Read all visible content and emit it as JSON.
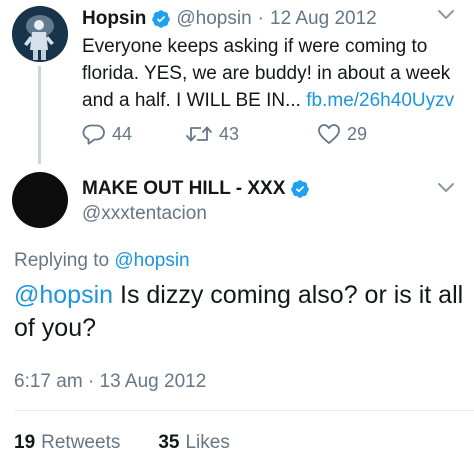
{
  "tweet1": {
    "name": "Hopsin",
    "handle": "@hopsin",
    "separator": "·",
    "date": "12 Aug 2012",
    "body_lines": [
      "Everyone keeps asking if were coming to",
      "florida. YES, we are buddy! in about a week",
      "and a half. I WILL BE IN..."
    ],
    "link": "fb.me/26h40Uyzv",
    "replies": "44",
    "retweets": "43",
    "likes": "29"
  },
  "tweet2": {
    "name": "MAKE OUT HILL - XXX",
    "handle": "@xxxtentacion",
    "replying_prefix": "Replying to",
    "replying_handle": "@hopsin",
    "mention": "@hopsin",
    "body_line1_rest": " Is dizzy coming also? or is it all",
    "body_line2": "of you?",
    "time": "6:17 am",
    "separator": "·",
    "date": "13 Aug 2012",
    "retweets_count": "19",
    "retweets_label": "Retweets",
    "likes_count": "35",
    "likes_label": "Likes"
  },
  "icons": {
    "verified": "verified-badge-icon",
    "caret": "chevron-down-icon",
    "reply": "reply-bubble-icon",
    "retweet": "retweet-icon",
    "like": "heart-icon"
  },
  "colors": {
    "accent": "#1da1f2",
    "link": "#1b95e0",
    "muted": "#657786",
    "text": "#14171a",
    "thread_line": "#ccd6dd"
  }
}
